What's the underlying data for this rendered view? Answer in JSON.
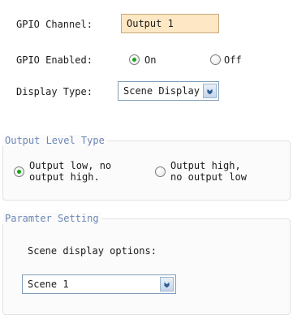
{
  "gpio": {
    "channel_label": "GPIO Channel:",
    "channel_value": "Output 1",
    "enabled_label": "GPIO Enabled:",
    "enabled_on": "On",
    "enabled_off": "Off",
    "enabled_selected": "On",
    "display_type_label": "Display Type:",
    "display_type_value": "Scene Display"
  },
  "output_level": {
    "title": "Output Level Type",
    "option_low_line1": "Output low, no",
    "option_low_line2": "output high.",
    "option_high_line1": "Output high,",
    "option_high_line2": "no output low",
    "selected": "low"
  },
  "parameter": {
    "title": "Paramter Setting",
    "scene_label": "Scene display options:",
    "scene_value": "Scene 1"
  },
  "colors": {
    "input_bg": "#fde7c4",
    "radio_selected": "#1aa31a",
    "group_title": "#6b87b5"
  },
  "icons": {
    "dropdown": "chevron-down-icon"
  }
}
